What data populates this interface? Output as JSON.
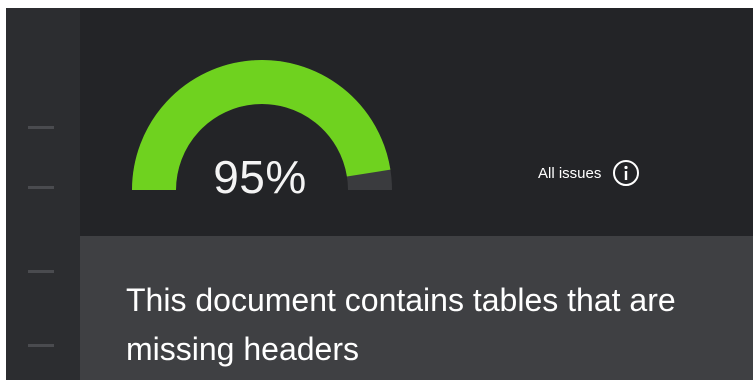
{
  "score": {
    "value_text": "95%",
    "fraction": 0.95,
    "arc_color": "#6fd21f",
    "track_color": "#3a3b3e"
  },
  "issues_link": {
    "label": "All issues",
    "icon": "info-icon"
  },
  "message": {
    "text": "This document contains tables that are missing headers"
  }
}
